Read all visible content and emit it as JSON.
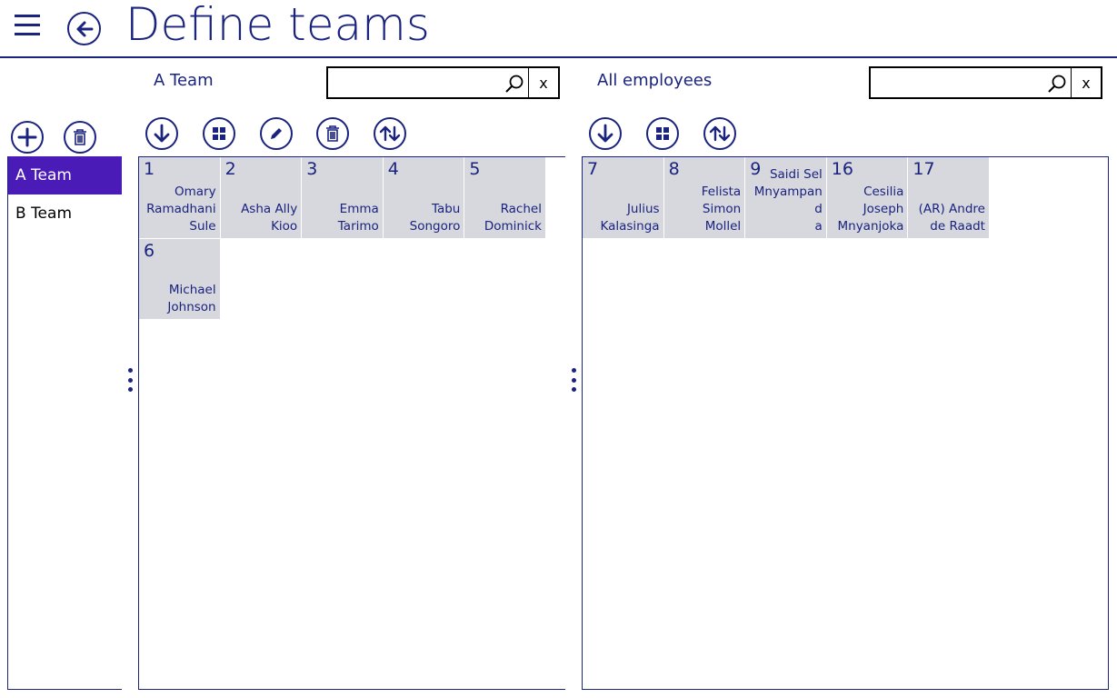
{
  "header": {
    "title": "Define teams"
  },
  "teams": {
    "items": [
      {
        "label": "A Team",
        "selected": true
      },
      {
        "label": "B Team",
        "selected": false
      }
    ],
    "toolbar": [
      "add-icon",
      "trash-icon"
    ]
  },
  "members": {
    "title": "A Team",
    "search": {
      "value": "",
      "clear_label": "x"
    },
    "toolbar": [
      "arrow-down-icon",
      "grid-icon",
      "pencil-icon",
      "trash-icon",
      "sort-icon"
    ],
    "tiles": [
      {
        "id": "1",
        "name": "Omary\nRamadhani\nSule"
      },
      {
        "id": "2",
        "name": "Asha Ally\nKioo"
      },
      {
        "id": "3",
        "name": "Emma\nTarimo"
      },
      {
        "id": "4",
        "name": "Tabu\nSongoro"
      },
      {
        "id": "5",
        "name": "Rachel\nDominick"
      },
      {
        "id": "6",
        "name": "Michael\nJohnson"
      }
    ]
  },
  "employees": {
    "title": "All employees",
    "search": {
      "value": "",
      "clear_label": "x"
    },
    "toolbar": [
      "arrow-down-icon",
      "grid-icon",
      "sort-icon"
    ],
    "tiles": [
      {
        "id": "7",
        "name": "Julius\nKalasinga"
      },
      {
        "id": "8",
        "name": "Felista\nSimon\nMollel"
      },
      {
        "id": "9",
        "name": "Saidi Sel\nMnyampand\na"
      },
      {
        "id": "16",
        "name": "Cesilia\nJoseph\nMnyanjoka"
      },
      {
        "id": "17",
        "name": "(AR) Andre\nde Raadt"
      }
    ]
  },
  "colors": {
    "accent": "#1a237e",
    "selected": "#4b1bb8",
    "tile": "#d7d7de"
  }
}
